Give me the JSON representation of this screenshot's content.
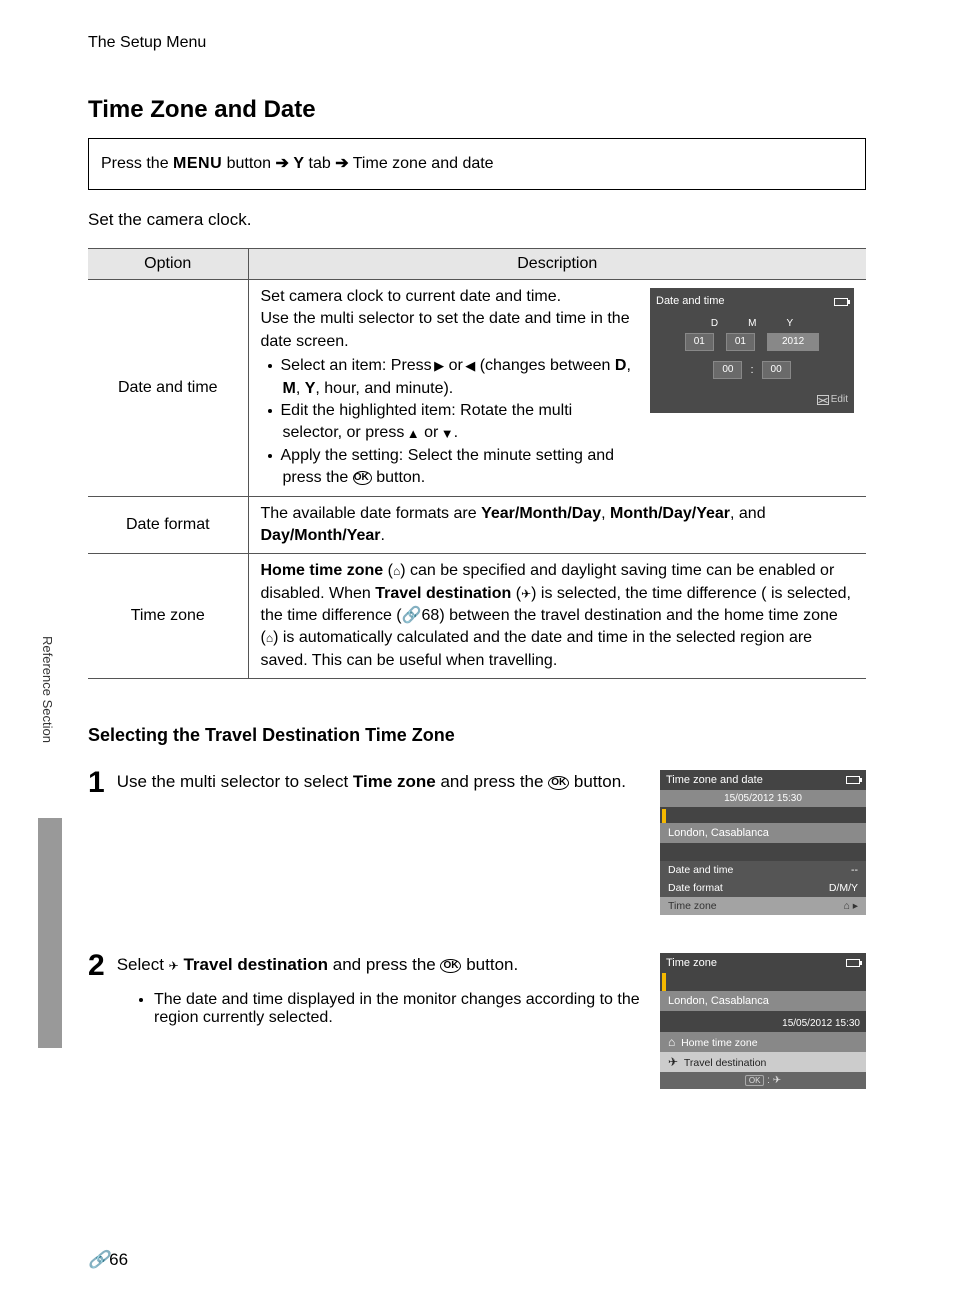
{
  "header": {
    "section": "The Setup Menu"
  },
  "title": "Time Zone and Date",
  "navPath": {
    "prefix": "Press the ",
    "menuWord": "MENU",
    "mid1": " button ",
    "arrow": "➔",
    "tabIcon": "Y",
    "mid2": " tab ",
    "tail": " Time zone and date"
  },
  "intro": "Set the camera clock.",
  "tableHeaders": {
    "option": "Option",
    "description": "Description"
  },
  "rows": {
    "dateAndTime": {
      "option": "Date and time",
      "descLine1": "Set camera clock to current date and time.",
      "descLine2": "Use the multi selector to set the date and time in the date screen.",
      "b1a": "Select an item: Press ",
      "b1b": " or ",
      "b1c": " (changes between ",
      "b1d": ", ",
      "b1e": ", ",
      "b1f": ", hour, and minute).",
      "dmy": {
        "D": "D",
        "M": "M",
        "Y": "Y"
      },
      "b2a": "Edit the highlighted item: Rotate the multi selector, or press ",
      "b2b": " or ",
      "b2c": ".",
      "b3a": "Apply the setting: Select the minute setting and press the ",
      "b3b": " button."
    },
    "dateFormat": {
      "option": "Date format",
      "preText": "The available date formats are ",
      "f1": "Year/Month/Day",
      "sep1": ", ",
      "f2": "Month/Day/Year",
      "sep2": ", and ",
      "f3": "Day/Month/Year",
      "tail": "."
    },
    "timeZone": {
      "option": "Time zone",
      "t1": "Home time zone",
      "t2": " (",
      "t3": ") can be specified and daylight saving time can be enabled or disabled. When ",
      "t4": "Travel destination",
      "t5": " (",
      "t6": ") is selected, the time difference (",
      "ref": "68",
      "refIcon": "🔗",
      "t7": ") between the travel destination and the home time zone (",
      "t8": ") is automatically calculated and the date and time in the selected region are saved. This can be useful when travelling."
    }
  },
  "cam1": {
    "title": "Date and time",
    "D": "D",
    "M": "M",
    "Y": "Y",
    "vD": "01",
    "vM": "01",
    "vY": "2012",
    "vH": "00",
    "vMin": "00",
    "editLabel": "Edit"
  },
  "subheading": "Selecting the Travel Destination Time Zone",
  "step1": {
    "num": "1",
    "textA": "Use the multi selector to select ",
    "bold": "Time zone",
    "textB": " and press the ",
    "textC": " button."
  },
  "cam2": {
    "title": "Time zone and date",
    "date": "15/05/2012 15:30",
    "city": "London, Casablanca",
    "opt1": "Date and time",
    "opt1val": "--",
    "opt2": "Date format",
    "opt2val": "D/M/Y",
    "opt3": "Time zone",
    "opt3icon": "⌂"
  },
  "step2": {
    "num": "2",
    "textA": "Select ",
    "bold": "Travel destination",
    "textB": " and press the ",
    "textC": " button.",
    "subBullet": "The date and time displayed in the monitor changes according to the region currently selected."
  },
  "cam3": {
    "title": "Time zone",
    "city": "London, Casablanca",
    "date": "15/05/2012 15:30",
    "opt1": "Home time zone",
    "opt2": "Travel destination",
    "foot": ":"
  },
  "sideTab": "Reference Section",
  "pageNumber": "66",
  "icons": {
    "ok": "OK",
    "right": "▶",
    "left": "◀",
    "up": "▲",
    "down": "▼",
    "home": "⌂",
    "plane": "✈"
  }
}
